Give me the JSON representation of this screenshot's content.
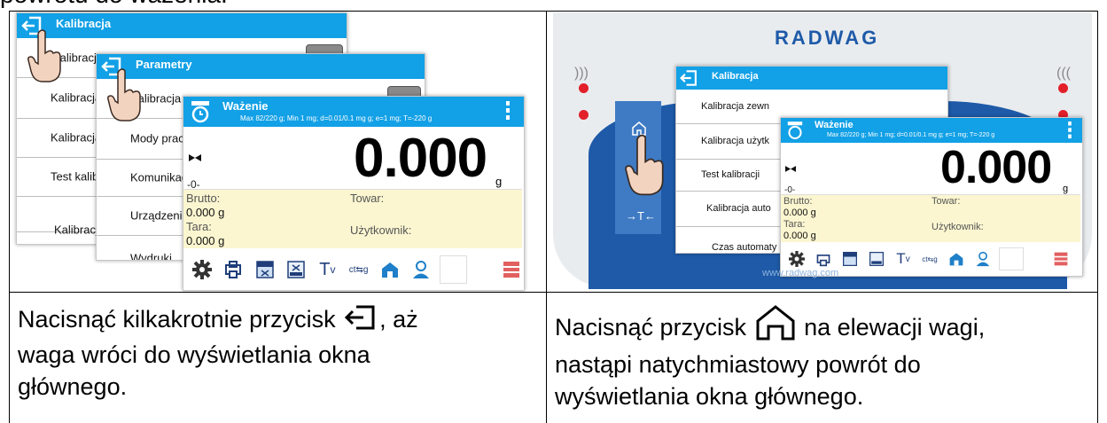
{
  "heading": "powrotu do ważenia.",
  "left": {
    "back_window": {
      "title": "Kalibracja",
      "rows": [
        "Kalibracja wewnętrzna",
        "Kalibracja",
        "Kalibracja",
        "Test kalibr",
        "Kalibracja"
      ]
    },
    "middle_window": {
      "title": "Parametry",
      "rows": [
        "Kalibracja",
        "Mody pracy",
        "Komunikac",
        "Urządzenia",
        "Wydruki"
      ]
    },
    "weigh_window": {
      "title": "Ważenie",
      "subtitle": "Max 82/220 g; Min 1 mg; d=0.01/0.1 mg g; e=1 mg; T=-220 g",
      "reading": "0.000",
      "unit": "g",
      "zero_mark": "-0-",
      "brutto_label": "Brutto:",
      "brutto_value": "0.000 g",
      "towar_label": "Towar:",
      "tara_label": "Tara:",
      "tara_value": "0.000 g",
      "user_label": "Użytkownik:"
    },
    "caption": [
      "Nacisnąć kilkakrotnie przycisk",
      ", aż",
      "waga wróci do wyświetlania okna",
      "głównego."
    ]
  },
  "right": {
    "brand": "RADWAG",
    "side_key": "→T←",
    "website": "www.radwag.com",
    "back_window": {
      "title": "Kalibracja",
      "rows": [
        "Kalibracja zewn",
        "Kalibracja użytk",
        "Test kalibracji",
        "Kalibracja auto",
        "Czas automaty"
      ]
    },
    "weigh_window": {
      "title": "Ważenie",
      "subtitle": "Max 82/220 g; Min 1 mg; d=0.01/0.1 mg g; e=1 mg; T=-220 g",
      "reading": "0.000",
      "unit": "g",
      "zero_mark": "-0-",
      "brutto_label": "Brutto:",
      "brutto_value": "0.000 g",
      "towar_label": "Towar:",
      "tara_label": "Tara:",
      "tara_value": "0.000 g",
      "user_label": "Użytkownik:"
    },
    "caption": [
      "Nacisnąć przycisk",
      "na elewacji wagi,",
      "nastąpi natychmiastowy powrót do",
      "wyświetlania okna głównego."
    ]
  },
  "colors": {
    "accent": "#12a0e6",
    "info_panel": "#fbf6d0",
    "led": "#e2202a",
    "panel_blue": "#1e5aa8"
  },
  "icons": [
    "back-icon",
    "home-icon",
    "gear-icon",
    "balance-icon",
    "hand-pointer-icon"
  ]
}
